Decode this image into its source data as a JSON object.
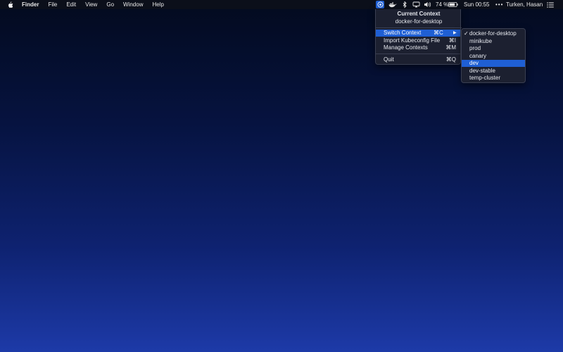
{
  "menubar": {
    "app_name": "Finder",
    "menus": [
      "File",
      "Edit",
      "View",
      "Go",
      "Window",
      "Help"
    ],
    "battery_percent": "74 %",
    "clock": "Sun 00:55",
    "user": "Turken, Hasan",
    "icons": [
      "apple-icon",
      "kubernetes-icon",
      "docker-icon",
      "bluetooth-icon",
      "airplay-icon",
      "volume-icon",
      "battery-icon",
      "notification-center-icon"
    ]
  },
  "context_menu": {
    "header_title": "Current Context",
    "current_context": "docker-for-desktop",
    "items": [
      {
        "label": "Switch Context",
        "shortcut": "⌘C",
        "has_submenu": true,
        "highlighted": true
      },
      {
        "label": "Import Kubeconfig File",
        "shortcut": "⌘I"
      },
      {
        "label": "Manage Contexts",
        "shortcut": "⌘M"
      },
      {
        "label": "Quit",
        "shortcut": "⌘Q"
      }
    ],
    "submenu_arrow": "▶"
  },
  "contexts_submenu": {
    "check_mark": "✓",
    "items": [
      {
        "label": "docker-for-desktop",
        "checked": true
      },
      {
        "label": "minikube"
      },
      {
        "label": "prod"
      },
      {
        "label": "canary"
      },
      {
        "label": "dev",
        "highlighted": true
      },
      {
        "label": "dev-stable"
      },
      {
        "label": "temp-cluster"
      }
    ]
  },
  "colors": {
    "menubar_bg": "#0b0f1a",
    "menu_bg": "#1c2030",
    "highlight": "#1f5fd4",
    "desktop_top": "#030a1e",
    "desktop_bottom": "#1d3aa8"
  }
}
